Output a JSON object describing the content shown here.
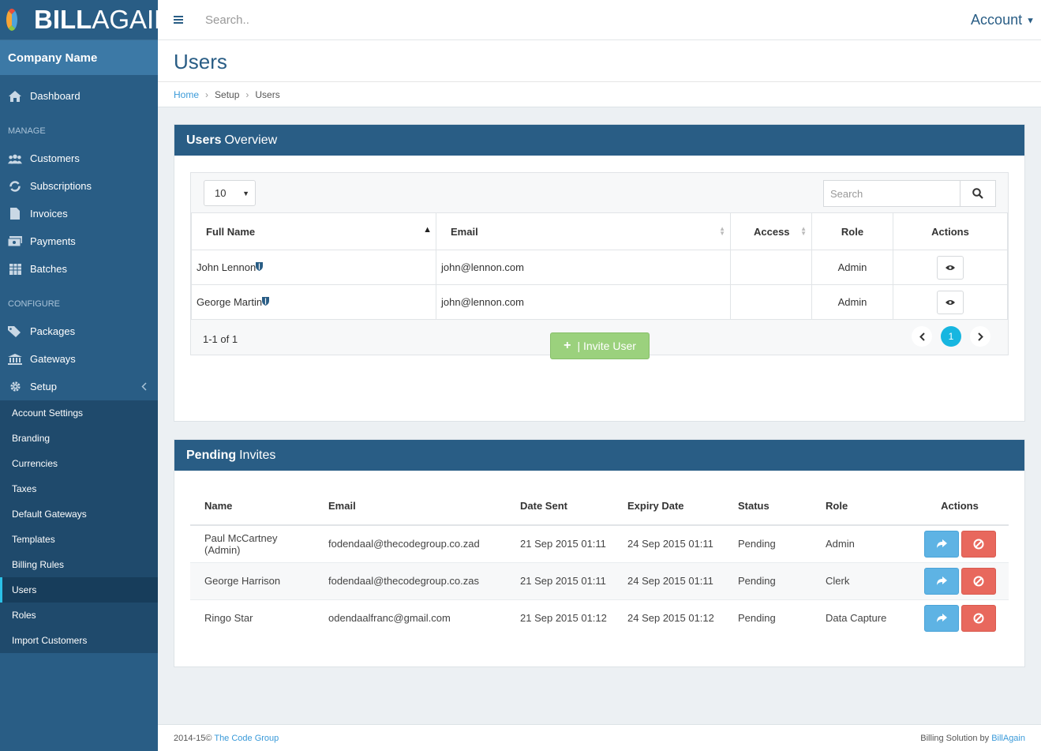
{
  "brand": {
    "bold": "BILL",
    "light": "AGAIN"
  },
  "company_name": "Company Name",
  "sidebar": {
    "dashboard": "Dashboard",
    "manage_label": "MANAGE",
    "manage": [
      "Customers",
      "Subscriptions",
      "Invoices",
      "Payments",
      "Batches"
    ],
    "configure_label": "CONFIGURE",
    "configure": [
      "Packages",
      "Gateways",
      "Setup"
    ],
    "setup_sub": [
      "Account Settings",
      "Branding",
      "Currencies",
      "Taxes",
      "Default Gateways",
      "Templates",
      "Billing Rules",
      "Users",
      "Roles",
      "Import Customers"
    ],
    "active": "Users"
  },
  "topbar": {
    "search_placeholder": "Search..",
    "account": "Account"
  },
  "page_title": "Users",
  "breadcrumb": [
    "Home",
    "Setup",
    "Users"
  ],
  "users_panel": {
    "title_bold": "Users",
    "title_rest": "Overview",
    "page_length": "10",
    "search_placeholder": "Search",
    "columns": [
      "Full Name",
      "Email",
      "Access",
      "Role",
      "Actions"
    ],
    "rows": [
      {
        "name": "John Lennon",
        "email": "john@lennon.com",
        "access": "",
        "role": "Admin"
      },
      {
        "name": "George Martin",
        "email": "john@lennon.com",
        "access": "",
        "role": "Admin"
      }
    ],
    "info": "1-1 of 1",
    "current_page": "1",
    "invite_label": "| Invite User"
  },
  "pending_panel": {
    "title_bold": "Pending",
    "title_rest": "Invites",
    "columns": [
      "Name",
      "Email",
      "Date Sent",
      "Expiry Date",
      "Status",
      "Role",
      "Actions"
    ],
    "rows": [
      {
        "name": "Paul McCartney (Admin)",
        "email": "fodendaal@thecodegroup.co.zad",
        "sent": "21 Sep 2015 01:11",
        "expiry": "24 Sep 2015 01:11",
        "status": "Pending",
        "role": "Admin"
      },
      {
        "name": "George Harrison",
        "email": "fodendaal@thecodegroup.co.zas",
        "sent": "21 Sep 2015 01:11",
        "expiry": "24 Sep 2015 01:11",
        "status": "Pending",
        "role": "Clerk"
      },
      {
        "name": "Ringo Star",
        "email": "odendaalfranc@gmail.com",
        "sent": "21 Sep 2015 01:12",
        "expiry": "24 Sep 2015 01:12",
        "status": "Pending",
        "role": "Data Capture"
      }
    ]
  },
  "footer": {
    "left_prefix": "2014-15©",
    "left_link": "The Code Group",
    "right_prefix": "Billing Solution by",
    "right_link": "BillAgain"
  }
}
